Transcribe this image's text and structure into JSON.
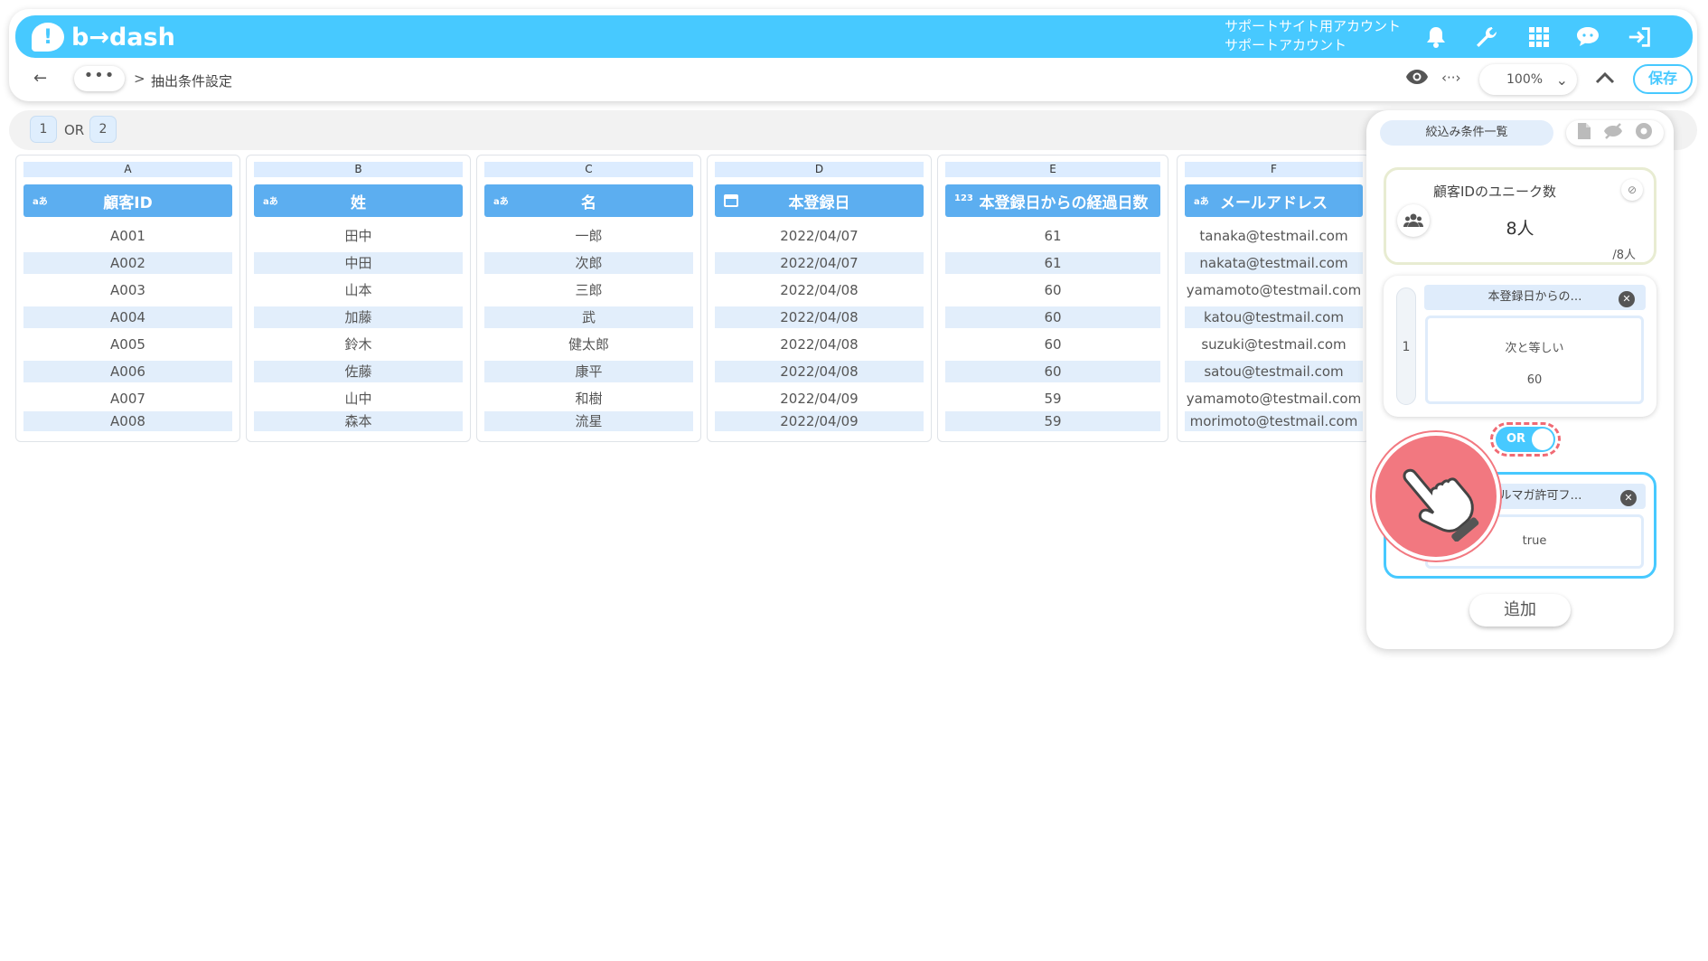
{
  "header": {
    "logo_mark": "!",
    "logo_text": "b→dash",
    "account_line1": "サポートサイト用アカウント",
    "account_line2": "サポートアカウント",
    "icons": [
      "bell-icon",
      "wrench-icon",
      "grid-icon",
      "support-chat-icon",
      "logout-icon"
    ]
  },
  "nav": {
    "back": "←",
    "more": "•••",
    "separator": ">",
    "breadcrumb": "抽出条件設定",
    "code_symbol": "‹··›",
    "zoom": "100%",
    "zoom_caret": "⌄",
    "save": "保存"
  },
  "conditions_strip": {
    "chip1": "1",
    "operator": "OR",
    "chip2": "2"
  },
  "table": {
    "columns": [
      {
        "letter": "A",
        "type": "aあ",
        "name": "顧客ID",
        "cells": [
          "A001",
          "A002",
          "A003",
          "A004",
          "A005",
          "A006",
          "A007",
          "A008"
        ]
      },
      {
        "letter": "B",
        "type": "aあ",
        "name": "姓",
        "cells": [
          "田中",
          "中田",
          "山本",
          "加藤",
          "鈴木",
          "佐藤",
          "山中",
          "森本"
        ]
      },
      {
        "letter": "C",
        "type": "aあ",
        "name": "名",
        "cells": [
          "一郎",
          "次郎",
          "三郎",
          "武",
          "健太郎",
          "康平",
          "和樹",
          "流星"
        ]
      },
      {
        "letter": "D",
        "type": "calendar",
        "name": "本登録日",
        "cells": [
          "2022/04/07",
          "2022/04/07",
          "2022/04/08",
          "2022/04/08",
          "2022/04/08",
          "2022/04/08",
          "2022/04/09",
          "2022/04/09"
        ]
      },
      {
        "letter": "E",
        "type": "123",
        "name": "本登録日からの経過日数",
        "cells": [
          "61",
          "61",
          "60",
          "60",
          "60",
          "60",
          "59",
          "59"
        ]
      },
      {
        "letter": "F",
        "type": "aあ",
        "name": "メールアドレス",
        "cells": [
          "tanaka@testmail.com",
          "nakata@testmail.com",
          "yamamoto@testmail.com",
          "katou@testmail.com",
          "suzuki@testmail.com",
          "satou@testmail.com",
          "yamamoto@testmail.com",
          "morimoto@testmail.com"
        ]
      }
    ]
  },
  "panel": {
    "tab_label": "絞込み条件一覧",
    "stat": {
      "label": "顧客IDのユニーク数",
      "value": "8人",
      "total": "/8人"
    },
    "group1": {
      "number": "1",
      "title": "本登録日からの…",
      "operator": "次と等しい",
      "value": "60"
    },
    "toggle_label": "OR",
    "group2": {
      "title": "メルマガ許可フ…",
      "value": "true"
    },
    "add": "追加"
  },
  "colors": {
    "brand": "#47c9ff",
    "header_col": "#5caef0",
    "alt_row": "#e2eefb",
    "cursor": "#f27880"
  }
}
